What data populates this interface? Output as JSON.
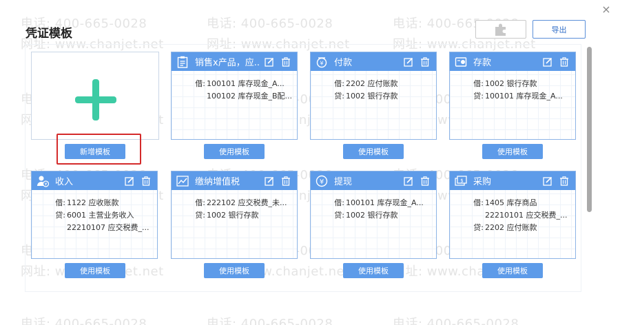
{
  "watermark": {
    "phone": "电话: 400-665-0028",
    "site": "网址: www.chanjet.net"
  },
  "dialog": {
    "title": "凭证模板",
    "export_label": "导出",
    "close_glyph": "×",
    "icons": {
      "close": "close-icon",
      "plugin": "puzzle-icon",
      "add": "plus-icon",
      "edit": "edit-icon",
      "delete": "trash-icon"
    }
  },
  "new_template": {
    "label": "新增模板"
  },
  "use_label": "使用模板",
  "colors": {
    "accent": "#5d9be9",
    "plus": "#3dcba4",
    "highlight": "#d42a2a"
  },
  "templates": [
    {
      "name": "销售x产品，应...",
      "icon": "document-icon",
      "lines": [
        {
          "label": "借:",
          "value": "100101 库存现金_A..."
        },
        {
          "label": "",
          "value": "100102 库存现金_B配..."
        }
      ]
    },
    {
      "name": "付款",
      "icon": "payment-icon",
      "lines": [
        {
          "label": "借:",
          "value": "2202 应付账款"
        },
        {
          "label": "贷:",
          "value": "1002 银行存款"
        }
      ]
    },
    {
      "name": "存款",
      "icon": "deposit-icon",
      "lines": [
        {
          "label": "借:",
          "value": "1002 银行存款"
        },
        {
          "label": "贷:",
          "value": "100101 库存现金_A..."
        }
      ]
    },
    {
      "name": "收入",
      "icon": "income-icon",
      "lines": [
        {
          "label": "借:",
          "value": "1122 应收账款"
        },
        {
          "label": "贷:",
          "value": "6001 主营业务收入"
        },
        {
          "label": "",
          "value": "22210107 应交税费_..."
        }
      ]
    },
    {
      "name": "缴纳增值税",
      "icon": "tax-chart-icon",
      "lines": [
        {
          "label": "借:",
          "value": "222102 应交税费_未..."
        },
        {
          "label": "贷:",
          "value": "1002 银行存款"
        }
      ]
    },
    {
      "name": "提现",
      "icon": "withdraw-icon",
      "lines": [
        {
          "label": "借:",
          "value": "100101 库存现金_A..."
        },
        {
          "label": "贷:",
          "value": "1002 银行存款"
        }
      ]
    },
    {
      "name": "采购",
      "icon": "purchase-icon",
      "lines": [
        {
          "label": "借:",
          "value": "1405 库存商品"
        },
        {
          "label": "",
          "value": "22210101 应交税费_..."
        },
        {
          "label": "贷:",
          "value": "2202 应付账款"
        }
      ]
    }
  ]
}
